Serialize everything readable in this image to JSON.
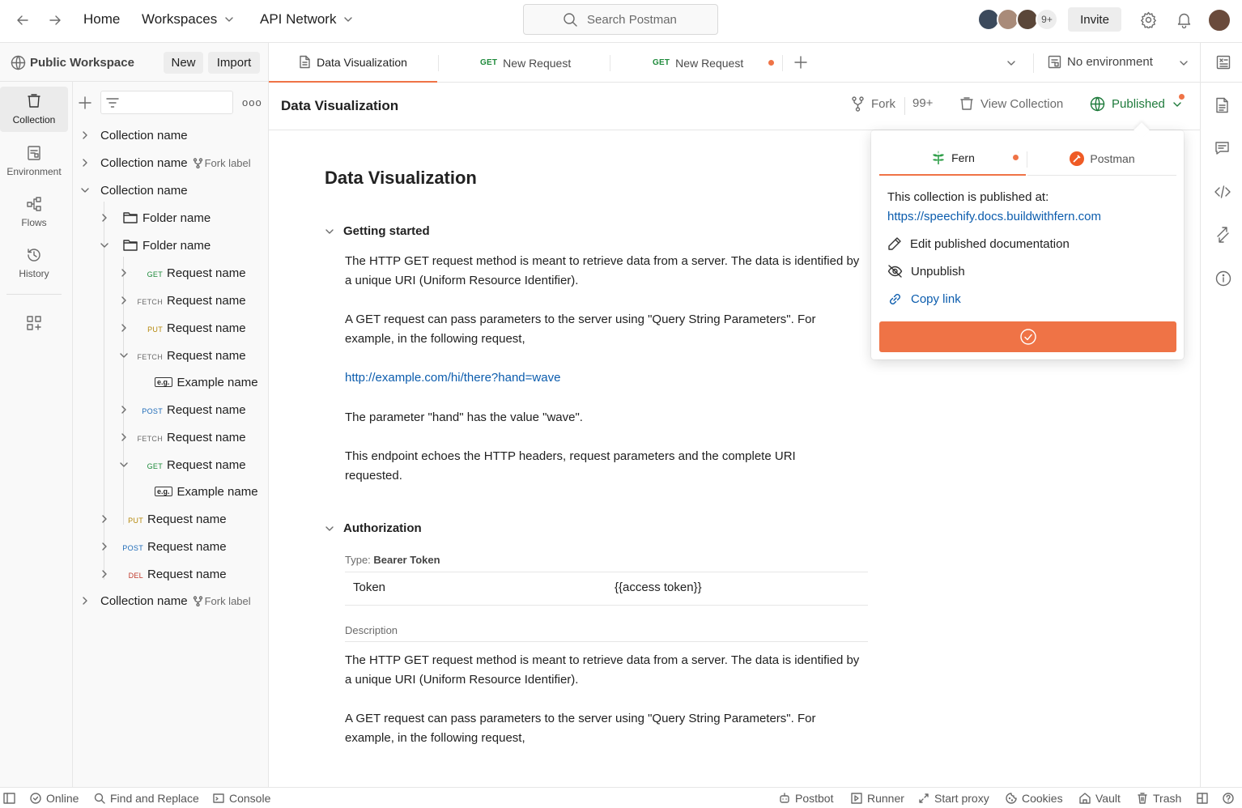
{
  "topbar": {
    "home": "Home",
    "workspaces": "Workspaces",
    "api_network": "API Network",
    "search_placeholder": "Search Postman",
    "avatar_count": "9+",
    "invite": "Invite"
  },
  "workspace": {
    "name": "Public Workspace",
    "new": "New",
    "import": "Import"
  },
  "tabs": [
    {
      "method": "",
      "label": "Data Visualization",
      "active": true
    },
    {
      "method": "GET",
      "label": "New Request"
    },
    {
      "method": "GET",
      "label": "New Request",
      "unsaved": true
    }
  ],
  "environment": "No environment",
  "rail": [
    {
      "label": "Collection",
      "icon": "collection-icon"
    },
    {
      "label": "Environment",
      "icon": "environment-icon"
    },
    {
      "label": "Flows",
      "icon": "flows-icon"
    },
    {
      "label": "History",
      "icon": "history-icon"
    }
  ],
  "tree": {
    "rows": [
      {
        "text": "Collection name"
      },
      {
        "text": "Collection name",
        "fork": "Fork label"
      },
      {
        "text": "Collection name"
      },
      {
        "text": "Folder name"
      },
      {
        "text": "Folder name"
      },
      {
        "method": "GET",
        "text": "Request name"
      },
      {
        "method": "FETCH",
        "text": "Request name"
      },
      {
        "method": "PUT",
        "text": "Request name"
      },
      {
        "method": "FETCH",
        "text": "Request name"
      },
      {
        "eg": "e.g.",
        "text": "Example name"
      },
      {
        "method": "POST",
        "text": "Request name"
      },
      {
        "method": "FETCH",
        "text": "Request name"
      },
      {
        "method": "GET",
        "text": "Request name"
      },
      {
        "eg": "e.g.",
        "text": "Example name"
      },
      {
        "method": "PUT",
        "text": "Request name"
      },
      {
        "method": "POST",
        "text": "Request name"
      },
      {
        "method": "DEL",
        "text": "Request name"
      },
      {
        "text": "Collection name",
        "fork": "Fork label"
      }
    ]
  },
  "header": {
    "title": "Data Visualization",
    "fork": "Fork",
    "fork_count": "99+",
    "view_collection": "View Collection",
    "published": "Published"
  },
  "doc": {
    "title": "Data Visualization",
    "getting_started": "Getting started",
    "p1": "The HTTP GET request method is meant to retrieve data from a server. The data is identified by a unique URI (Uniform Resource Identifier).",
    "p2": "A GET request can pass parameters to the server using \"Query String Parameters\". For example, in the following request,",
    "link": "http://example.com/hi/there?hand=wave",
    "p3": "The parameter \"hand\" has the value \"wave\".",
    "p4": "This endpoint echoes the HTTP headers, request parameters and the complete URI requested.",
    "authorization": "Authorization",
    "type_label": "Type:",
    "type_value": "Bearer Token",
    "token_key": "Token",
    "token_value": "{{access token}}",
    "description": "Description",
    "p5": "The HTTP GET request method is meant to retrieve data from a server. The data is identified by a unique URI (Uniform Resource Identifier).",
    "p6": "A GET request can pass parameters to the server using \"Query String Parameters\". For example, in the following request,"
  },
  "popup": {
    "tab_fern": "Fern",
    "tab_postman": "Postman",
    "published_at": "This collection is published at:",
    "url": "https://speechify.docs.buildwithfern.com",
    "edit": "Edit published documentation",
    "unpublish": "Unpublish",
    "copy": "Copy link"
  },
  "status": {
    "online": "Online",
    "find": "Find and Replace",
    "console": "Console",
    "postbot": "Postbot",
    "runner": "Runner",
    "proxy": "Start proxy",
    "cookies": "Cookies",
    "vault": "Vault",
    "trash": "Trash"
  },
  "colors": {
    "accent": "#ef7346",
    "link": "#0b5cad",
    "published_green": "#1e7a3b",
    "get": "#1e8a3b",
    "put": "#b5880b",
    "post": "#1e6bb8",
    "del": "#c0392b",
    "fetch": "#6b6b6b"
  }
}
